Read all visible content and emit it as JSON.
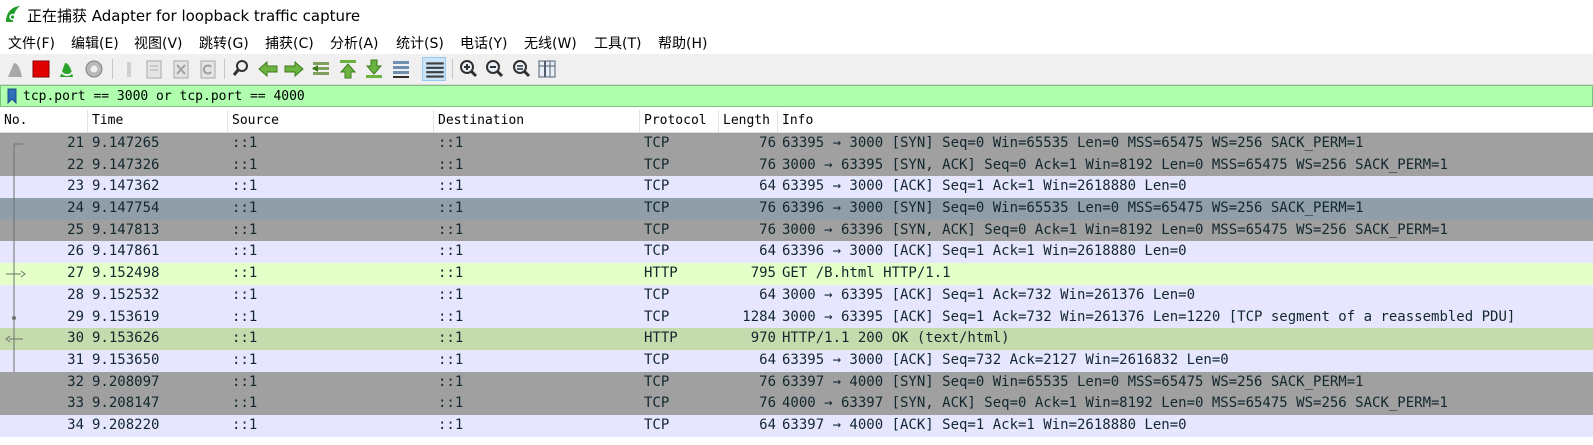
{
  "window": {
    "title": "正在捕获 Adapter for loopback traffic capture"
  },
  "menu": [
    "文件(F)",
    "编辑(E)",
    "视图(V)",
    "跳转(G)",
    "捕获(C)",
    "分析(A)",
    "统计(S)",
    "电话(Y)",
    "无线(W)",
    "工具(T)",
    "帮助(H)"
  ],
  "filter": {
    "value": "tcp.port == 3000 or tcp.port == 4000"
  },
  "columns": {
    "no": "No.",
    "time": "Time",
    "source": "Source",
    "destination": "Destination",
    "protocol": "Protocol",
    "length": "Length",
    "info": "Info"
  },
  "colors": {
    "tcp_syn_bg": "#a0a0a0",
    "tcp_bg": "#e7e6ff",
    "http_bg": "#e4ffc7",
    "http_response_bg": "#c6dbad",
    "selected_bg": "#8f9ea9",
    "filter_bg": "#afffaf"
  },
  "packets": [
    {
      "no": "21",
      "time": "9.147265",
      "source": "::1",
      "destination": "::1",
      "protocol": "TCP",
      "length": "76",
      "info": "63395 → 3000 [SYN] Seq=0 Win=65535 Len=0 MSS=65475 WS=256 SACK_PERM=1",
      "bg": "#a0a0a0"
    },
    {
      "no": "22",
      "time": "9.147326",
      "source": "::1",
      "destination": "::1",
      "protocol": "TCP",
      "length": "76",
      "info": "3000 → 63395 [SYN, ACK] Seq=0 Ack=1 Win=8192 Len=0 MSS=65475 WS=256 SACK_PERM=1",
      "bg": "#a0a0a0"
    },
    {
      "no": "23",
      "time": "9.147362",
      "source": "::1",
      "destination": "::1",
      "protocol": "TCP",
      "length": "64",
      "info": "63395 → 3000 [ACK] Seq=1 Ack=1 Win=2618880 Len=0",
      "bg": "#e7e6ff"
    },
    {
      "no": "24",
      "time": "9.147754",
      "source": "::1",
      "destination": "::1",
      "protocol": "TCP",
      "length": "76",
      "info": "63396 → 3000 [SYN] Seq=0 Win=65535 Len=0 MSS=65475 WS=256 SACK_PERM=1",
      "bg": "#8f9ea9"
    },
    {
      "no": "25",
      "time": "9.147813",
      "source": "::1",
      "destination": "::1",
      "protocol": "TCP",
      "length": "76",
      "info": "3000 → 63396 [SYN, ACK] Seq=0 Ack=1 Win=8192 Len=0 MSS=65475 WS=256 SACK_PERM=1",
      "bg": "#a0a0a0"
    },
    {
      "no": "26",
      "time": "9.147861",
      "source": "::1",
      "destination": "::1",
      "protocol": "TCP",
      "length": "64",
      "info": "63396 → 3000 [ACK] Seq=1 Ack=1 Win=2618880 Len=0",
      "bg": "#e7e6ff"
    },
    {
      "no": "27",
      "time": "9.152498",
      "source": "::1",
      "destination": "::1",
      "protocol": "HTTP",
      "length": "795",
      "info": "GET /B.html HTTP/1.1",
      "bg": "#e4ffc7"
    },
    {
      "no": "28",
      "time": "9.152532",
      "source": "::1",
      "destination": "::1",
      "protocol": "TCP",
      "length": "64",
      "info": "3000 → 63395 [ACK] Seq=1 Ack=732 Win=261376 Len=0",
      "bg": "#e7e6ff"
    },
    {
      "no": "29",
      "time": "9.153619",
      "source": "::1",
      "destination": "::1",
      "protocol": "TCP",
      "length": "1284",
      "info": "3000 → 63395 [ACK] Seq=1 Ack=732 Win=261376 Len=1220 [TCP segment of a reassembled PDU]",
      "bg": "#e7e6ff"
    },
    {
      "no": "30",
      "time": "9.153626",
      "source": "::1",
      "destination": "::1",
      "protocol": "HTTP",
      "length": "970",
      "info": "HTTP/1.1 200 OK  (text/html)",
      "bg": "#c6dbad"
    },
    {
      "no": "31",
      "time": "9.153650",
      "source": "::1",
      "destination": "::1",
      "protocol": "TCP",
      "length": "64",
      "info": "63395 → 3000 [ACK] Seq=732 Ack=2127 Win=2616832 Len=0",
      "bg": "#e7e6ff"
    },
    {
      "no": "32",
      "time": "9.208097",
      "source": "::1",
      "destination": "::1",
      "protocol": "TCP",
      "length": "76",
      "info": "63397 → 4000 [SYN] Seq=0 Win=65535 Len=0 MSS=65475 WS=256 SACK_PERM=1",
      "bg": "#a0a0a0"
    },
    {
      "no": "33",
      "time": "9.208147",
      "source": "::1",
      "destination": "::1",
      "protocol": "TCP",
      "length": "76",
      "info": "4000 → 63397 [SYN, ACK] Seq=0 Ack=1 Win=8192 Len=0 MSS=65475 WS=256 SACK_PERM=1",
      "bg": "#a0a0a0"
    },
    {
      "no": "34",
      "time": "9.208220",
      "source": "::1",
      "destination": "::1",
      "protocol": "TCP",
      "length": "64",
      "info": "63397 → 4000 [ACK] Seq=1 Ack=1 Win=2618880 Len=0",
      "bg": "#e7e6ff"
    }
  ],
  "toolbar_icons": [
    "shark-fin-start-icon",
    "stop-capture-icon",
    "restart-capture-icon",
    "capture-options-icon",
    "open-file-icon",
    "save-file-icon",
    "close-file-icon",
    "reload-file-icon",
    "find-packet-icon",
    "go-back-icon",
    "go-forward-icon",
    "go-to-packet-icon",
    "first-packet-icon",
    "last-packet-icon",
    "autoscroll-icon",
    "colorize-icon",
    "zoom-in-icon",
    "zoom-out-icon",
    "normal-size-icon",
    "resize-columns-icon"
  ]
}
